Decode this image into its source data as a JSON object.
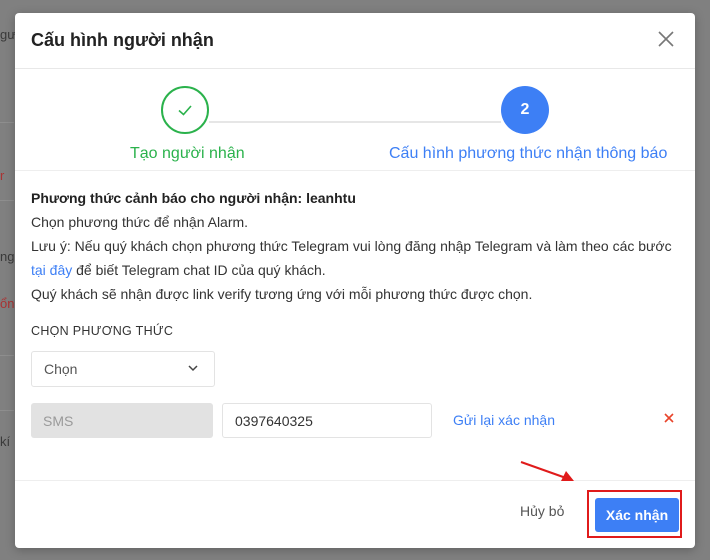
{
  "background_fragments": [
    "gư",
    "r",
    "ng",
    "ổng",
    "kí"
  ],
  "modal": {
    "title": "Cấu hình người nhận"
  },
  "stepper": {
    "step1_label": "Tạo người nhận",
    "step2_number": "2",
    "step2_label": "Cấu hình phương thức nhận thông báo"
  },
  "content": {
    "heading": "Phương thức cảnh báo cho người nhận: leanhtu",
    "line1": "Chọn phương thức để nhận Alarm.",
    "line2": "Lưu ý: Nếu quý khách chọn phương thức Telegram vui lòng đăng nhập Telegram và làm theo các bước",
    "link_text": "tại đây",
    "line3_suffix": " để biết Telegram chat ID của quý khách.",
    "line4": "Quý khách sẽ nhận được link verify tương ứng với mỗi phương thức được chọn."
  },
  "method_section": {
    "label": "CHỌN PHƯƠNG THỨC",
    "select_value": "Chọn"
  },
  "method_row": {
    "type": "SMS",
    "phone_value": "0397640325",
    "resend_label": "Gửi lại xác nhận"
  },
  "footer": {
    "cancel_label": "Hủy bỏ",
    "confirm_label": "Xác nhận"
  },
  "colors": {
    "accent": "#3d7ff5",
    "success": "#2bb24c",
    "danger": "#e01b1b"
  },
  "icons": {
    "close": "close-icon",
    "check": "check-icon",
    "chevron": "chevron-down-icon",
    "remove": "remove-icon"
  }
}
